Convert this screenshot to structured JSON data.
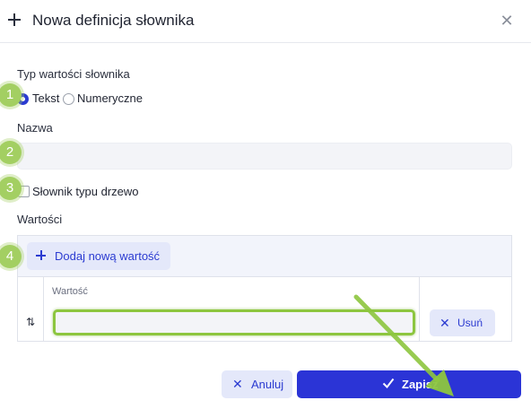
{
  "dialog": {
    "title": "Nowa definicja słownika",
    "close_symbol": "✕"
  },
  "form": {
    "type_label": "Typ wartości słownika",
    "type_options": [
      {
        "label": "Tekst",
        "selected": true
      },
      {
        "label": "Numeryczne",
        "selected": false
      }
    ],
    "name_label": "Nazwa",
    "name_value": "",
    "tree_checkbox_label": "Słownik typu drzewo",
    "tree_checked": false,
    "values_label": "Wartości",
    "add_value_label": "Dodaj nową wartość",
    "value_column_header": "Wartość",
    "rows": [
      {
        "value": "",
        "remove_label": "Usuń"
      }
    ]
  },
  "footer": {
    "cancel_label": "Anuluj",
    "save_label": "Zapisz"
  },
  "annotations": {
    "steps": [
      "1",
      "2",
      "3",
      "4"
    ],
    "highlight_color": "#8dc63f",
    "arrow_target": "save-button"
  },
  "icons": {
    "header": "plus-icon",
    "close": "close-icon",
    "add": "plus-icon",
    "sort": "sort-arrows-icon",
    "remove": "x-icon",
    "cancel": "x-icon",
    "save": "check-icon"
  },
  "colors": {
    "primary": "#2b34d6",
    "primary_light": "#e4e8fa",
    "annotation_green": "#a3cf62"
  }
}
